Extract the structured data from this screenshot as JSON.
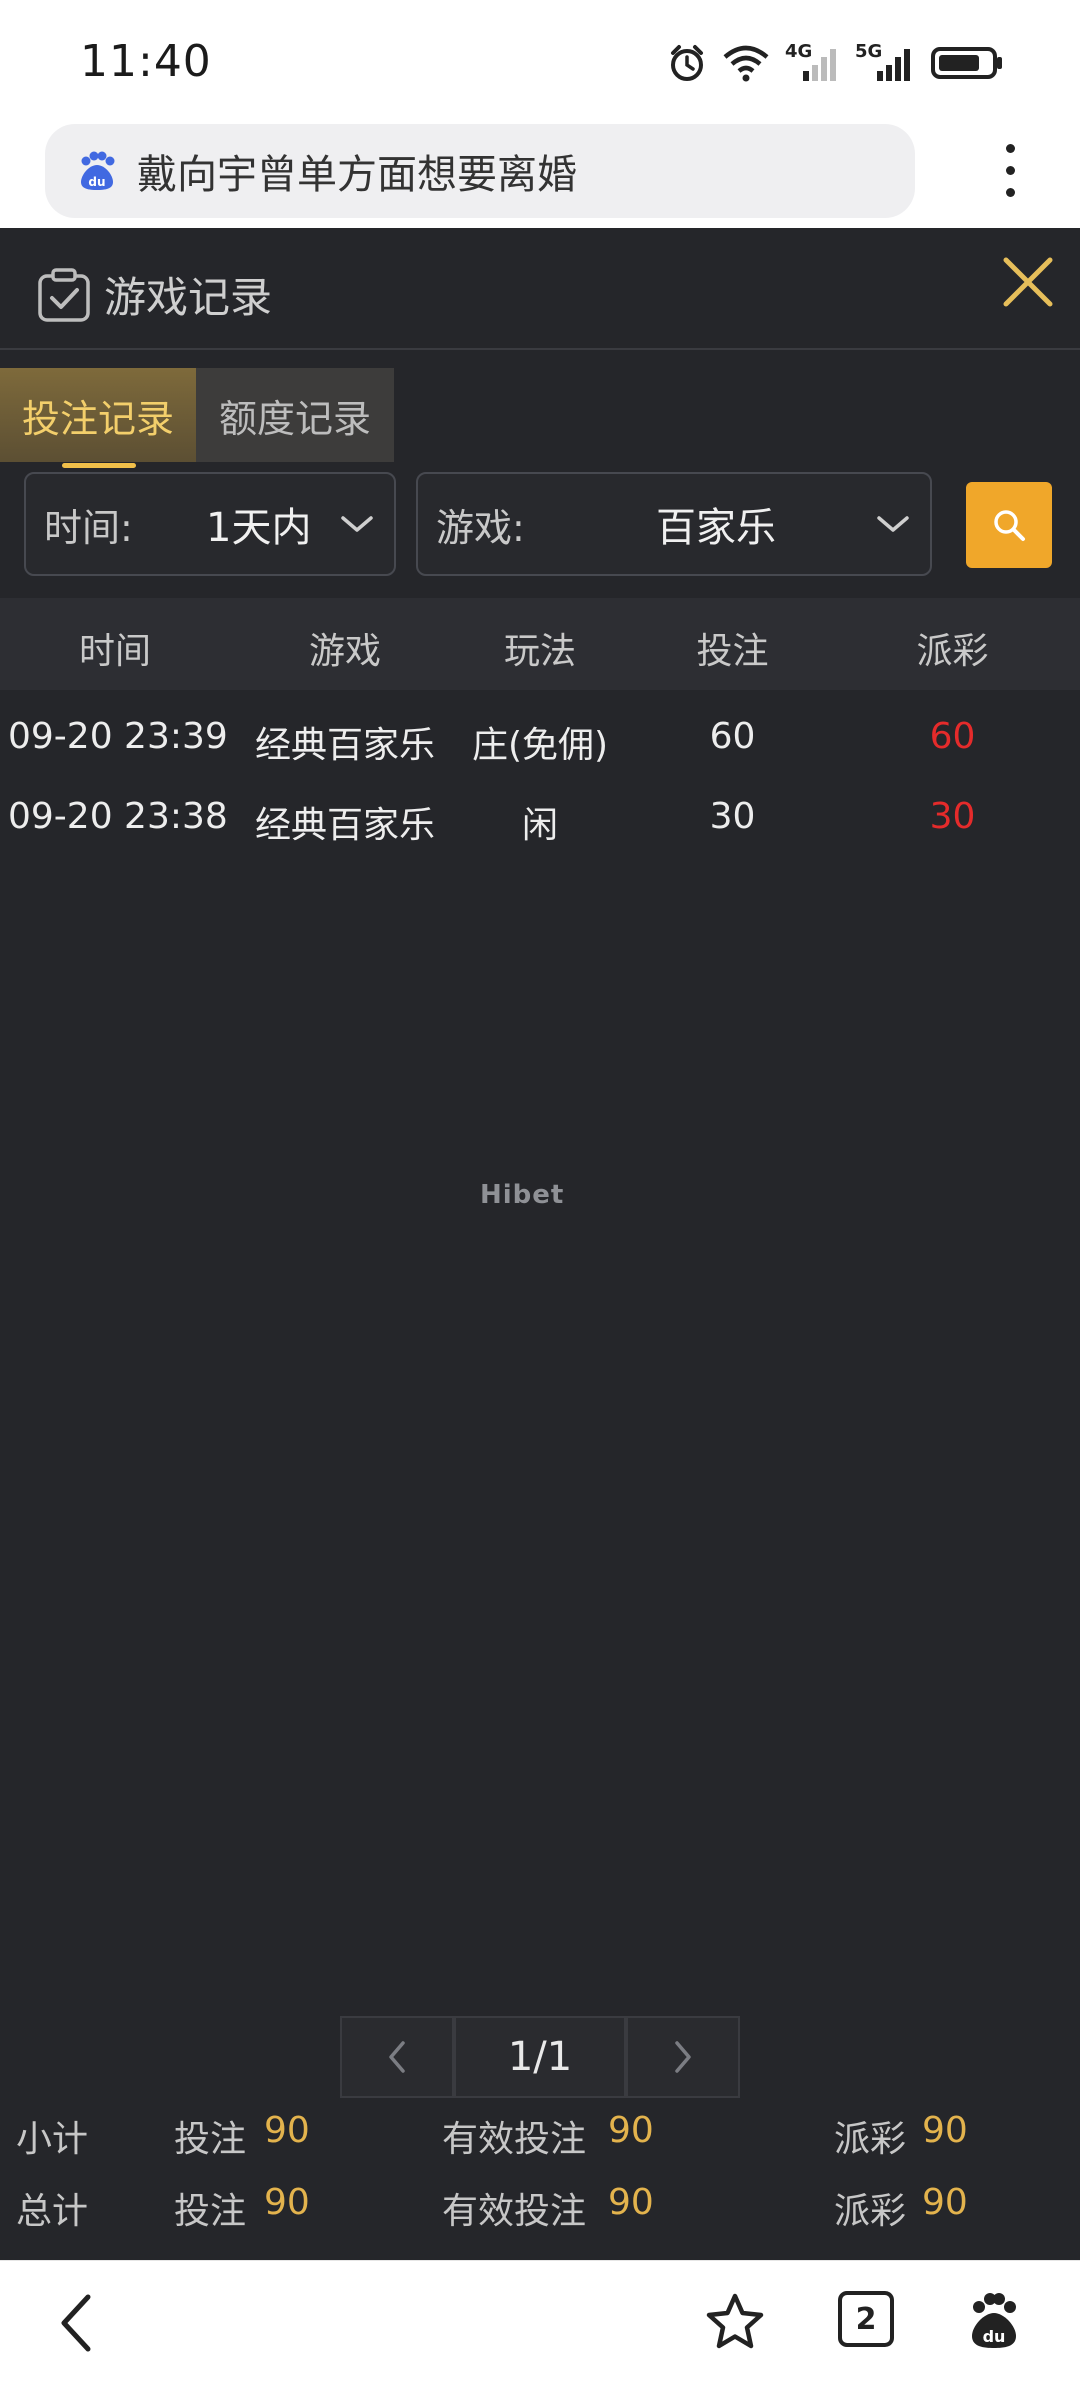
{
  "status_bar": {
    "time": "11:40",
    "signal_4g": "4G",
    "signal_5g": "5G"
  },
  "address_bar": {
    "query": "戴向宇曾单方面想要离婚"
  },
  "header": {
    "title": "游戏记录"
  },
  "tabs": [
    {
      "label": "投注记录",
      "active": true
    },
    {
      "label": "额度记录",
      "active": false
    }
  ],
  "filters": {
    "time_label": "时间:",
    "time_value": "1天内",
    "game_label": "游戏:",
    "game_value": "百家乐"
  },
  "table": {
    "columns": [
      "时间",
      "游戏",
      "玩法",
      "投注",
      "派彩"
    ],
    "rows": [
      {
        "time": "09-20 23:39",
        "game": "经典百家乐",
        "play": "庄(免佣)",
        "bet": "60",
        "payout": "60"
      },
      {
        "time": "09-20 23:38",
        "game": "经典百家乐",
        "play": "闲",
        "bet": "30",
        "payout": "30"
      }
    ]
  },
  "watermark": "Hibet",
  "pagination": {
    "current": "1/1"
  },
  "summary": {
    "subtotal": {
      "label": "小计",
      "bet_label": "投注",
      "bet": "90",
      "valid_label": "有效投注",
      "valid": "90",
      "payout_label": "派彩",
      "payout": "90"
    },
    "total": {
      "label": "总计",
      "bet_label": "投注",
      "bet": "90",
      "valid_label": "有效投注",
      "valid": "90",
      "payout_label": "派彩",
      "payout": "90"
    }
  },
  "bottom_nav": {
    "tab_count": "2"
  },
  "colors": {
    "accent_gold": "#f0a72a",
    "payout_red": "#e52b2b",
    "panel_bg": "#25262a"
  }
}
